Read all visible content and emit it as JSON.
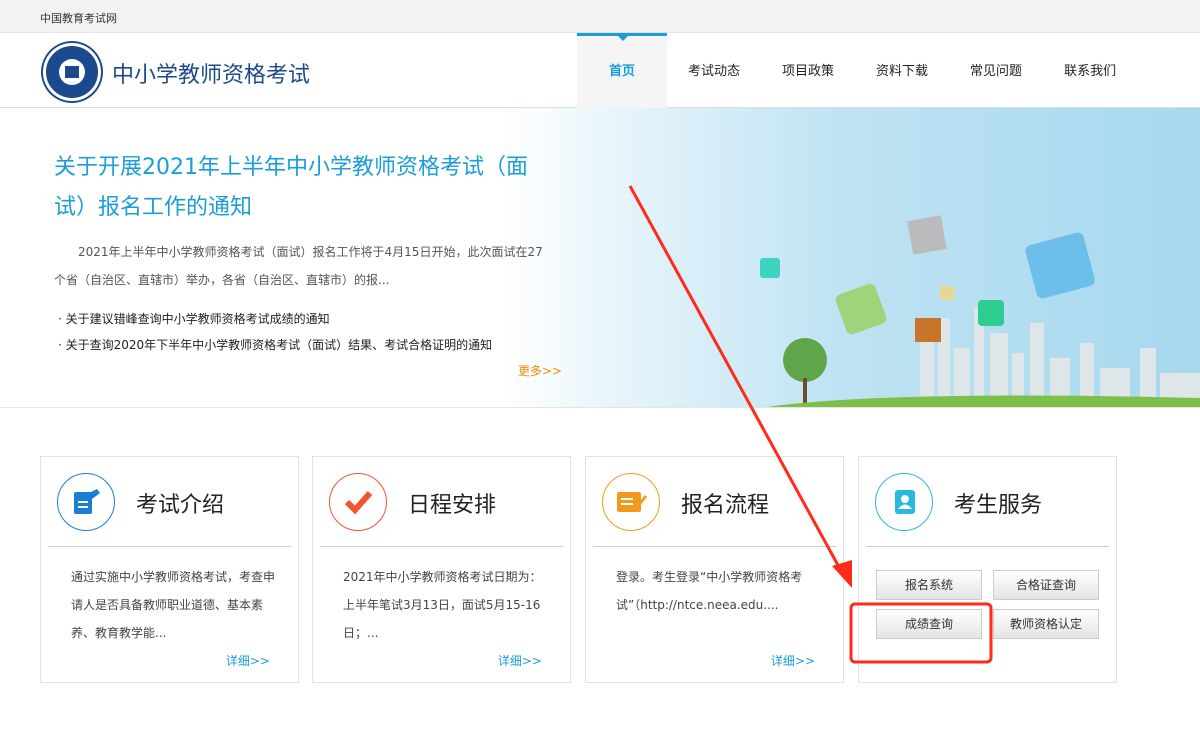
{
  "topbar": {
    "site": "中国教育考试网"
  },
  "header": {
    "title": "中小学教师资格考试",
    "nav": [
      "首页",
      "考试动态",
      "项目政策",
      "资料下载",
      "常见问题",
      "联系我们"
    ]
  },
  "banner": {
    "title": "关于开展2021年上半年中小学教师资格考试（面试）报名工作的通知",
    "desc": "2021年上半年中小学教师资格考试（面试）报名工作将于4月15日开始，此次面试在27个省（自治区、直辖市）举办，各省（自治区、直辖市）的报...",
    "links": [
      "关于建议错峰查询中小学教师资格考试成绩的通知",
      "关于查询2020年下半年中小学教师资格考试（面试）结果、考试合格证明的通知"
    ],
    "more": "更多>>"
  },
  "cards": [
    {
      "title": "考试介绍",
      "desc": "通过实施中小学教师资格考试，考查申请人是否具备教师职业道德、基本素养、教育教学能...",
      "link": "详细>>",
      "color": "#1a7fd4"
    },
    {
      "title": "日程安排",
      "desc": "2021年中小学教师资格考试日期为：上半年笔试3月13日，面试5月15-16日；...",
      "link": "详细>>",
      "color": "#f0562e"
    },
    {
      "title": "报名流程",
      "desc": "登录。考生登录“中小学教师资格考试”（http://ntce.neea.edu....",
      "link": "详细>>",
      "color": "#f39a1e"
    },
    {
      "title": "考生服务",
      "color": "#28b8e0",
      "buttons": [
        "报名系统",
        "合格证查询",
        "成绩查询",
        "教师资格认定"
      ]
    }
  ],
  "annotation_color": "#ff2a1a"
}
